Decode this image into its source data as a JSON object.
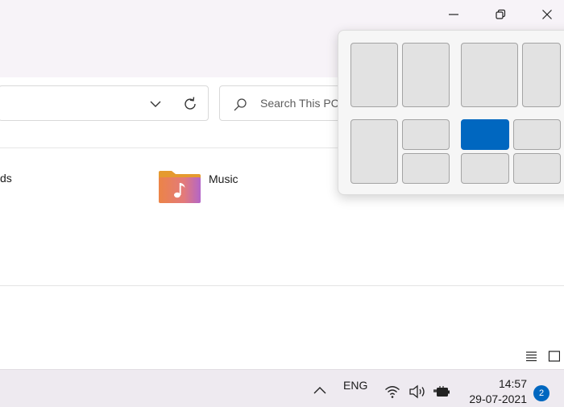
{
  "search": {
    "placeholder": "Search This PC"
  },
  "content": {
    "items": [
      {
        "label": "ds"
      },
      {
        "label": "Music"
      }
    ]
  },
  "taskbar": {
    "language": "ENG",
    "time": "14:57",
    "date": "29-07-2021",
    "notification_count": "2"
  },
  "colors": {
    "accent": "#0067c0"
  },
  "icons": {
    "minimize": "minimize-icon",
    "maximize": "restore-icon",
    "close": "close-icon",
    "search": "search-icon",
    "refresh": "refresh-icon",
    "folder": "music-folder-icon",
    "wifi": "wifi-icon",
    "volume": "volume-icon",
    "battery": "battery-icon"
  }
}
